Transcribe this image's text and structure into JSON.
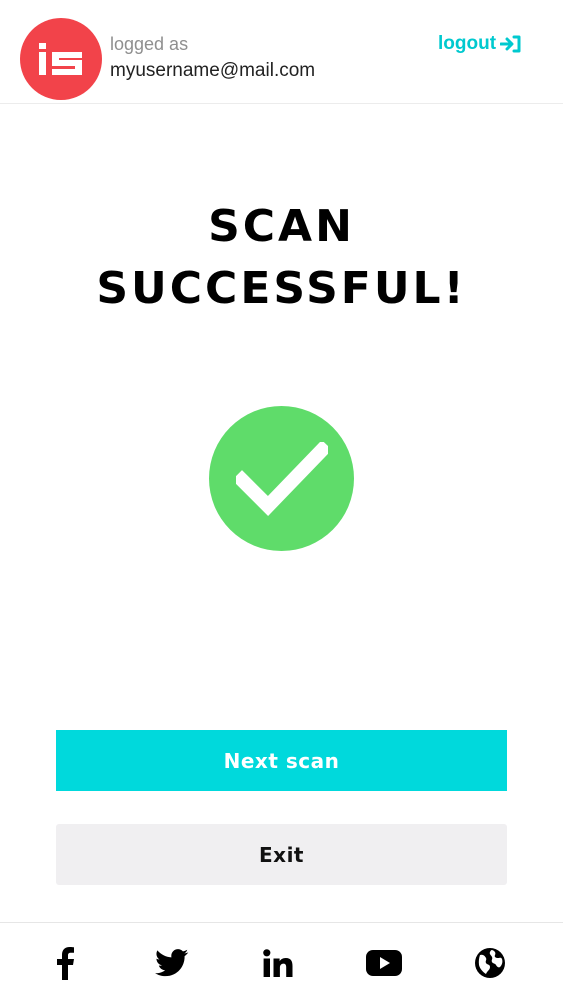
{
  "colors": {
    "brand_red": "#f2434a",
    "accent_cyan": "#00d9dc",
    "success_green": "#5fdc6a",
    "exit_bg": "#f0eff1"
  },
  "header": {
    "logo_icon": "is-logo-icon",
    "logged_as_label": "logged as",
    "username": "myusername@mail.com",
    "logout_label": "logout",
    "logout_icon": "sign-in-arrow-icon"
  },
  "main": {
    "title_line1": "SCAN",
    "title_line2": "SUCCESSFUL!",
    "status_icon": "checkmark-icon"
  },
  "actions": {
    "next_label": "Next scan",
    "exit_label": "Exit"
  },
  "footer": {
    "social_icons": [
      "facebook-icon",
      "twitter-icon",
      "linkedin-icon",
      "youtube-icon",
      "globe-icon"
    ]
  }
}
